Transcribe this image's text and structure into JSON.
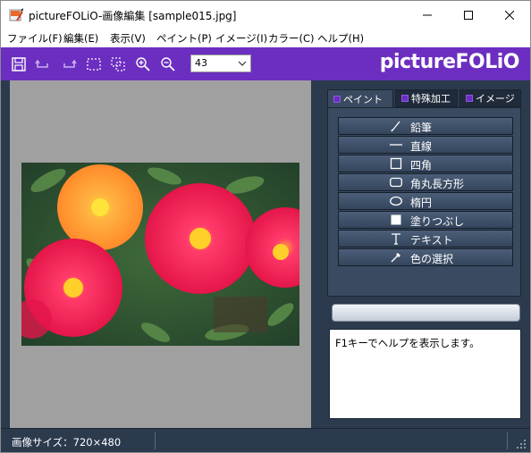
{
  "window": {
    "title": "pictureFOLiO-画像編集 [sample015.jpg]"
  },
  "menu": [
    "ファイル(F)",
    "編集(E)",
    "表示(V)",
    "ペイント(P)",
    "イメージ(I)",
    "カラー(C)",
    "ヘルプ(H)"
  ],
  "toolbar": {
    "icons": [
      "save-icon",
      "undo-icon",
      "redo-icon",
      "select-rect-icon",
      "select-crop-icon",
      "zoom-in-icon",
      "zoom-out-icon"
    ],
    "zoom_value": "43",
    "brand": "pictureFOLiO",
    "accent_color": "#6c2ec0"
  },
  "tabs": [
    "ペイント",
    "特殊加工",
    "イメージ"
  ],
  "tools": [
    {
      "label": "鉛筆",
      "icon": "pencil-icon"
    },
    {
      "label": "直線",
      "icon": "line-icon"
    },
    {
      "label": "四角",
      "icon": "rectangle-icon"
    },
    {
      "label": "角丸長方形",
      "icon": "rounded-rectangle-icon"
    },
    {
      "label": "楕円",
      "icon": "ellipse-icon"
    },
    {
      "label": "塗りつぶし",
      "icon": "fill-icon"
    },
    {
      "label": "テキスト",
      "icon": "text-icon"
    },
    {
      "label": "色の選択",
      "icon": "eyedropper-icon"
    }
  ],
  "help": {
    "text": "F1キーでヘルプを表示します。"
  },
  "status": {
    "image_size": "画像サイズ：720×480"
  }
}
